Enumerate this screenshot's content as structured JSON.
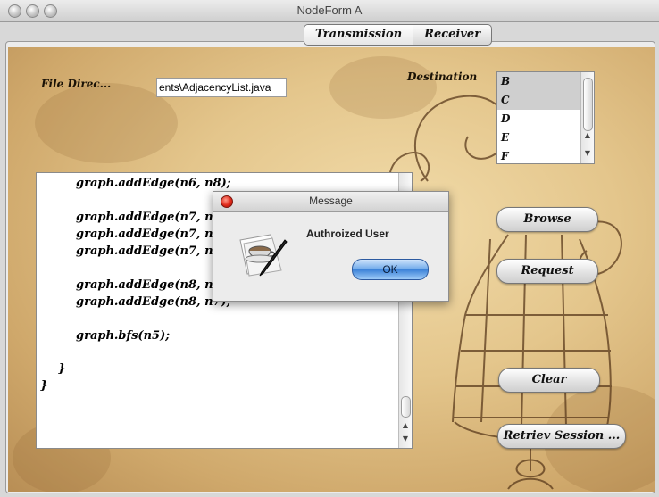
{
  "window": {
    "title": "NodeForm A"
  },
  "tabs": [
    {
      "label": "Transmission"
    },
    {
      "label": "Receiver"
    }
  ],
  "form": {
    "file_label": "File Direc...",
    "file_value": "ents\\AdjacencyList.java",
    "destination_label": "Destination"
  },
  "destination_list": {
    "items": [
      "B",
      "C",
      "D",
      "E",
      "F"
    ],
    "selected": [
      "B",
      "C"
    ]
  },
  "code_area": {
    "lines": [
      "graph.addEdge(n6, n8);",
      "",
      "graph.addEdge(n7, n5);",
      "graph.addEdge(n7, n6);",
      "graph.addEdge(n7, n8);",
      "",
      "graph.addEdge(n8, n6);",
      "graph.addEdge(n8, n7);",
      "",
      "graph.bfs(n5);",
      "",
      "}",
      "}"
    ]
  },
  "buttons": {
    "browse": "Browse",
    "request": "Request",
    "clear": "Clear",
    "retrieve": "Retriev Session ..."
  },
  "dialog": {
    "title": "Message",
    "message": "Authroized User",
    "ok": "OK"
  },
  "icons": {
    "dialog": "coffee-cup-pen-icon",
    "close": "close-icon"
  },
  "colors": {
    "parchment": "#e4c68c",
    "ok_button": "#3b82d8",
    "close_button": "#e0291a"
  }
}
